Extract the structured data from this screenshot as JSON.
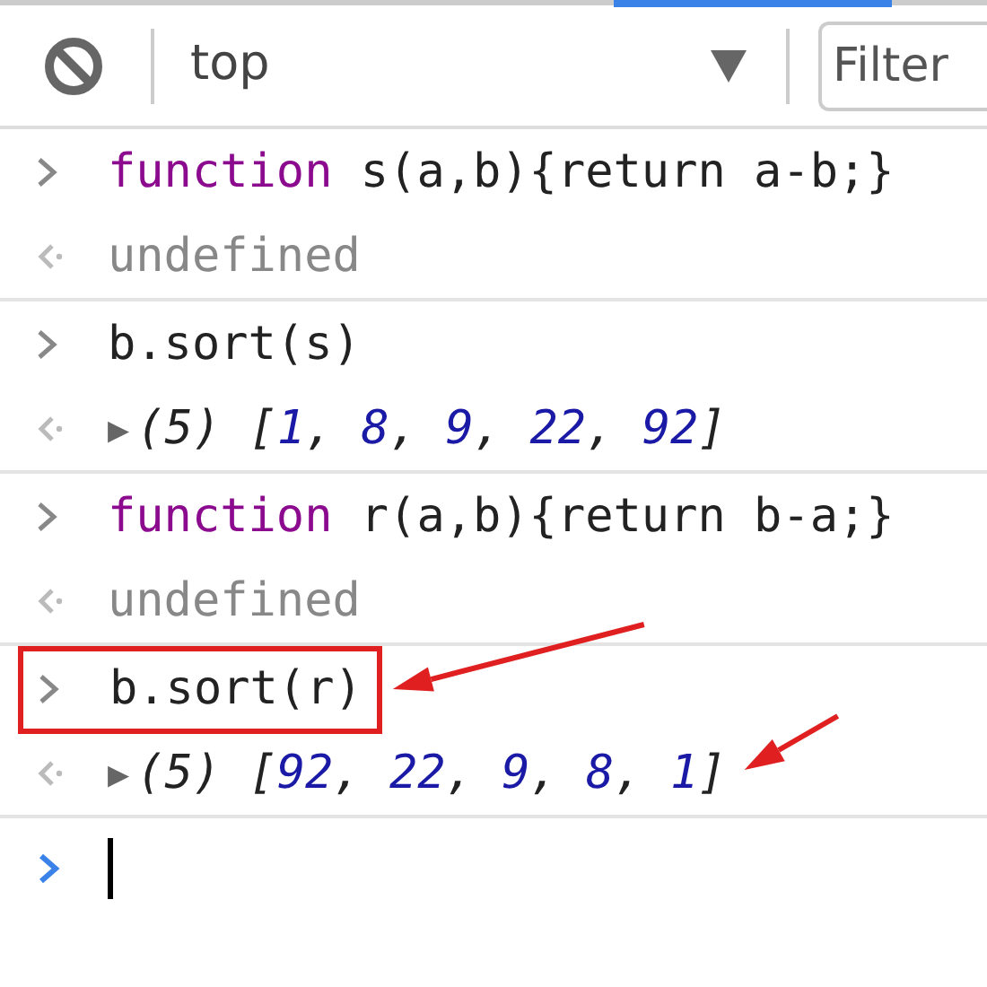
{
  "toolbar": {
    "context": "top",
    "filter_placeholder": "Filter"
  },
  "entries": [
    {
      "kind": "input",
      "tokens": [
        {
          "text": "function",
          "kind": "keyword"
        },
        {
          "text": " s(a,b){return a-b;}",
          "kind": "plain"
        }
      ],
      "highlighted": false,
      "arrow": false
    },
    {
      "kind": "undefined",
      "text": "undefined"
    },
    {
      "kind": "input",
      "tokens": [
        {
          "text": "b.sort(s)",
          "kind": "plain"
        }
      ],
      "highlighted": false,
      "arrow": false
    },
    {
      "kind": "array",
      "toggle": "▶",
      "tokens": [
        {
          "text": "(5) [",
          "kind": "plain"
        },
        {
          "text": "1",
          "kind": "number"
        },
        {
          "text": ", ",
          "kind": "plain"
        },
        {
          "text": "8",
          "kind": "number"
        },
        {
          "text": ", ",
          "kind": "plain"
        },
        {
          "text": "9",
          "kind": "number"
        },
        {
          "text": ", ",
          "kind": "plain"
        },
        {
          "text": "22",
          "kind": "number"
        },
        {
          "text": ", ",
          "kind": "plain"
        },
        {
          "text": "92",
          "kind": "number"
        },
        {
          "text": "]",
          "kind": "plain"
        }
      ],
      "arrow": false
    },
    {
      "kind": "input",
      "tokens": [
        {
          "text": "function",
          "kind": "keyword"
        },
        {
          "text": " r(a,b){return b-a;}",
          "kind": "plain"
        }
      ],
      "highlighted": false,
      "arrow": false
    },
    {
      "kind": "undefined",
      "text": "undefined"
    },
    {
      "kind": "input",
      "tokens": [
        {
          "text": "b.sort(r)",
          "kind": "plain"
        }
      ],
      "highlighted": true,
      "arrow": true
    },
    {
      "kind": "array",
      "toggle": "▶",
      "tokens": [
        {
          "text": "(5) [",
          "kind": "plain"
        },
        {
          "text": "92",
          "kind": "number"
        },
        {
          "text": ", ",
          "kind": "plain"
        },
        {
          "text": "22",
          "kind": "number"
        },
        {
          "text": ", ",
          "kind": "plain"
        },
        {
          "text": "9",
          "kind": "number"
        },
        {
          "text": ", ",
          "kind": "plain"
        },
        {
          "text": "8",
          "kind": "number"
        },
        {
          "text": ", ",
          "kind": "plain"
        },
        {
          "text": "1",
          "kind": "number"
        },
        {
          "text": "]",
          "kind": "plain"
        }
      ],
      "arrow": true
    }
  ]
}
